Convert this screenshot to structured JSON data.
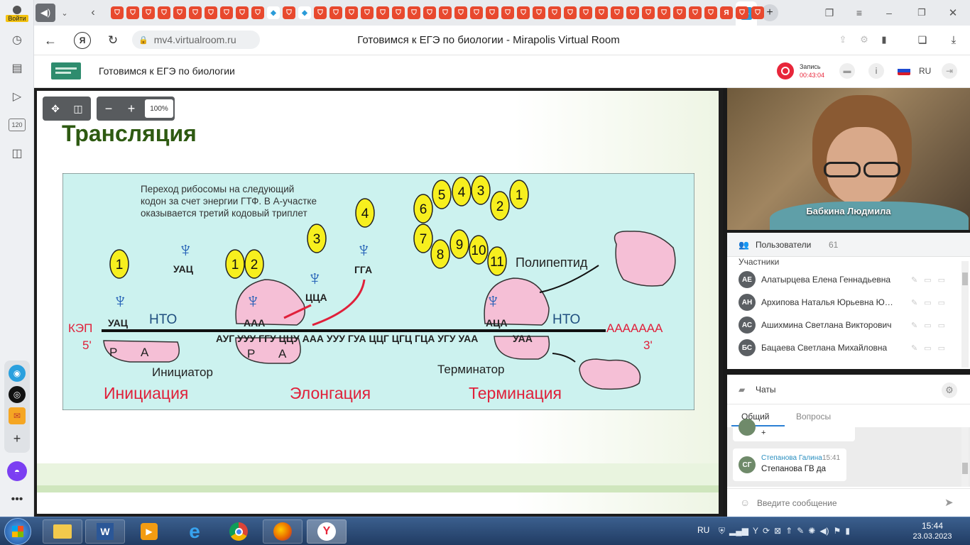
{
  "browser": {
    "login_label": "Войти",
    "url": "mv4.virtualroom.ru",
    "page_title": "Готовимся к ЕГЭ по биологии - Mirapolis Virtual Room",
    "sidebar_counter": "120"
  },
  "app": {
    "title": "Готовимся к ЕГЭ по биологии",
    "record_label": "Запись",
    "record_time": "00:43:04",
    "lang": "RU"
  },
  "toolbar": {
    "zoom": "100%"
  },
  "slide": {
    "title": "Трансляция",
    "caption": [
      "Переход рибосомы на следующий",
      "кодон за счет энергии ГТФ. В А-участке",
      "оказывается третий кодовый триплет"
    ],
    "labels": {
      "uac": "УАЦ",
      "nto": "НТО",
      "kep": "КЭП",
      "five": "5'",
      "three": "3'",
      "p": "Р",
      "a": "А",
      "aaa": "ААА",
      "cca": "ЦЦА",
      "gga": "ГГА",
      "aca": "АЦА",
      "uaa": "УАА",
      "polyA": "ААААААА",
      "polypeptide": "Полипептид",
      "initiator": "Инициатор",
      "terminator": "Терминатор",
      "sequence": "АУГ УУУ ГГУ ЦЦУ ААА УУУ ГУА ЦЦГ ЦГЦ ГЦА УГУ УАА"
    },
    "stages": [
      "Инициация",
      "Элонгация",
      "Терминация"
    ],
    "balls": [
      "1",
      "2",
      "3",
      "4",
      "5",
      "6",
      "7",
      "8",
      "9",
      "10",
      "11"
    ]
  },
  "video": {
    "speaker": "Бабкина Людмила"
  },
  "users": {
    "header": "Пользователи",
    "count": "61",
    "section": "Участники",
    "list": [
      {
        "initials": "АЕ",
        "name": "Алатырцева Елена Геннадьевна"
      },
      {
        "initials": "АН",
        "name": "Архипова Наталья Юрьевна Юр..."
      },
      {
        "initials": "АС",
        "name": "Ашихмина Светлана Викторович"
      },
      {
        "initials": "БС",
        "name": "Бацаева Светлана Михайловна"
      }
    ]
  },
  "chats": {
    "header": "Чаты",
    "tab_general": "Общий",
    "tab_questions": "Вопросы",
    "prev_msg": "+",
    "msg_initials": "СГ",
    "msg_author": "Степанова Галина",
    "msg_time": "15:41",
    "msg_text": "Степанова ГВ да",
    "input_placeholder": "Введите сообщение"
  },
  "taskbar": {
    "lang": "RU",
    "time": "15:44",
    "date": "23.03.2023"
  },
  "colors": {
    "accent": "#e8492e",
    "slide_bg": "#ccf2ef",
    "ball": "#f7ef1e",
    "ribosome": "#f5bfd6",
    "title_green": "#2e5a12",
    "stage_red": "#e0203a"
  }
}
